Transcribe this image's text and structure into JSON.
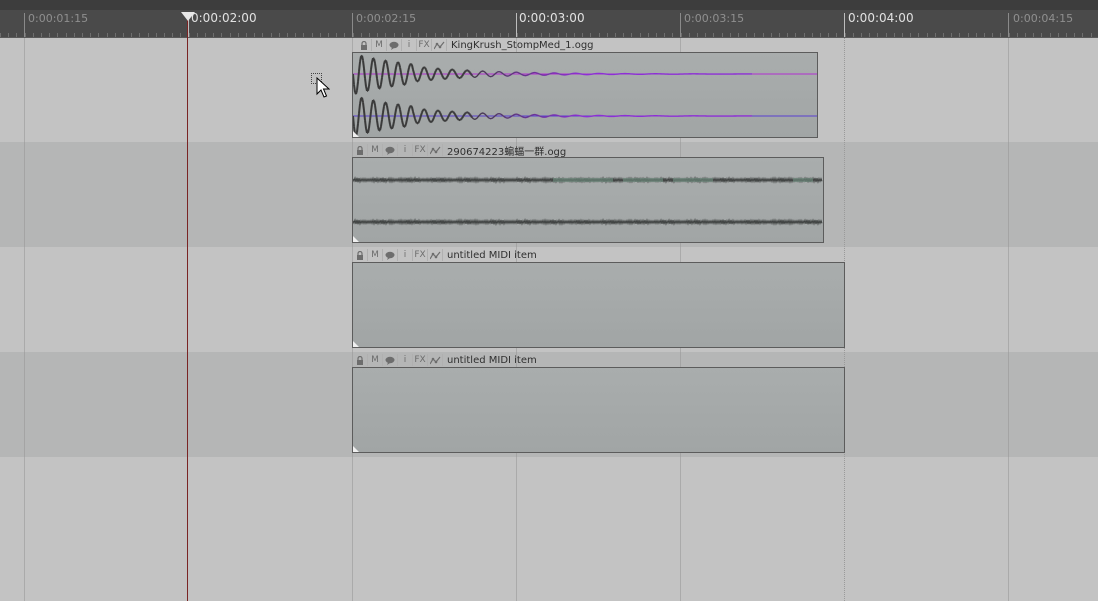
{
  "ruler": {
    "labels": {
      "t1": "0:00:01:15",
      "t2": "0:00:02:00",
      "t3": "0:00:02:15",
      "t4": "0:00:03:00",
      "t5": "0:00:03:15",
      "t6": "0:00:04:00",
      "t7": "0:00:04:15"
    }
  },
  "colors": {
    "lane_light": "#c3c3c3",
    "lane_dark": "#b5b6b6",
    "item_body": "#a5a9a9",
    "waveform_dark": "#3a3a3a",
    "waveform_purple": "#8d2fd6",
    "play_cursor": "#7a2424"
  },
  "item_buttons": {
    "lock": "lock-icon",
    "mute": "M",
    "notes": "speech-bubble-icon",
    "info": "i",
    "fx": "FX",
    "envelope": "envelope-icon"
  },
  "items": [
    {
      "name": "KingKrush_StompMed_1.ogg",
      "type": "audio"
    },
    {
      "name": "290674223蝙蝠一群.ogg",
      "type": "audio"
    },
    {
      "name": "untitled MIDI item",
      "type": "midi"
    },
    {
      "name": "untitled MIDI item",
      "type": "midi"
    }
  ]
}
